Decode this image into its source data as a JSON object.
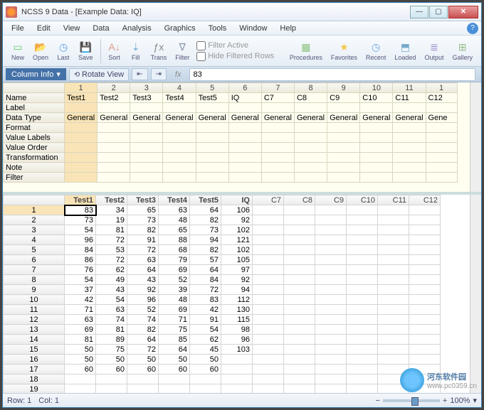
{
  "title": "NCSS 9 Data - [Example Data: IQ]",
  "menus": [
    "File",
    "Edit",
    "View",
    "Data",
    "Analysis",
    "Graphics",
    "Tools",
    "Window",
    "Help"
  ],
  "toolbar_left": [
    {
      "name": "new",
      "label": "New",
      "glyph": "▭",
      "color": "#6c6"
    },
    {
      "name": "open",
      "label": "Open",
      "glyph": "📂",
      "color": "#e9b64a"
    },
    {
      "name": "last",
      "label": "Last",
      "glyph": "◷",
      "color": "#5aa0e0"
    },
    {
      "name": "save",
      "label": "Save",
      "glyph": "💾",
      "color": "#5b8fd0"
    }
  ],
  "toolbar_mid": [
    {
      "name": "sort",
      "label": "Sort",
      "glyph": "A↓",
      "color": "#d98"
    },
    {
      "name": "fill",
      "label": "Fill",
      "glyph": "⇣",
      "color": "#7ac"
    },
    {
      "name": "trans",
      "label": "Trans",
      "glyph": "ƒx",
      "color": "#888"
    },
    {
      "name": "filter",
      "label": "Filter",
      "glyph": "∇",
      "color": "#89a"
    }
  ],
  "filter_opts": {
    "active": "Filter Active",
    "hide": "Hide Filtered Rows"
  },
  "toolbar_right": [
    {
      "name": "procedures",
      "label": "Procedures",
      "glyph": "▦",
      "color": "#8ac17c"
    },
    {
      "name": "favorites",
      "label": "Favorites",
      "glyph": "★",
      "color": "#f2c84b"
    },
    {
      "name": "recent",
      "label": "Recent",
      "glyph": "◷",
      "color": "#6aa6e0"
    },
    {
      "name": "loaded",
      "label": "Loaded",
      "glyph": "⬒",
      "color": "#7ac"
    },
    {
      "name": "output",
      "label": "Output",
      "glyph": "≣",
      "color": "#9688c8"
    },
    {
      "name": "gallery",
      "label": "Gallery",
      "glyph": "⊞",
      "color": "#9b8"
    }
  ],
  "colbar": {
    "info": "Column Info",
    "pin": "▾",
    "rotate": "Rotate View",
    "fx": "fx",
    "cell_value": "83"
  },
  "column_headers": [
    "1",
    "2",
    "3",
    "4",
    "5",
    "6",
    "7",
    "8",
    "9",
    "10",
    "11",
    "1"
  ],
  "info_rows": [
    "Name",
    "Label",
    "Data Type",
    "Format",
    "Value Labels",
    "Value Order",
    "Transformation",
    "Note",
    "Filter"
  ],
  "info_data": {
    "Name": [
      "Test1",
      "Test2",
      "Test3",
      "Test4",
      "Test5",
      "IQ",
      "C7",
      "C8",
      "C9",
      "C10",
      "C11",
      "C12"
    ],
    "Data Type": [
      "General",
      "General",
      "General",
      "General",
      "General",
      "General",
      "General",
      "General",
      "General",
      "General",
      "General",
      "Gene"
    ]
  },
  "data_headers": [
    "Test1",
    "Test2",
    "Test3",
    "Test4",
    "Test5",
    "IQ",
    "C7",
    "C8",
    "C9",
    "C10",
    "C11",
    "C12"
  ],
  "data_rows": [
    [
      83,
      34,
      65,
      63,
      64,
      106
    ],
    [
      73,
      19,
      73,
      48,
      82,
      92
    ],
    [
      54,
      81,
      82,
      65,
      73,
      102
    ],
    [
      96,
      72,
      91,
      88,
      94,
      121
    ],
    [
      84,
      53,
      72,
      68,
      82,
      102
    ],
    [
      86,
      72,
      63,
      79,
      57,
      105
    ],
    [
      76,
      62,
      64,
      69,
      64,
      97
    ],
    [
      54,
      49,
      43,
      52,
      84,
      92
    ],
    [
      37,
      43,
      92,
      39,
      72,
      94
    ],
    [
      42,
      54,
      96,
      48,
      83,
      112
    ],
    [
      71,
      63,
      52,
      69,
      42,
      130
    ],
    [
      63,
      74,
      74,
      71,
      91,
      115
    ],
    [
      69,
      81,
      82,
      75,
      54,
      98
    ],
    [
      81,
      89,
      64,
      85,
      62,
      96
    ],
    [
      50,
      75,
      72,
      64,
      45,
      103
    ],
    [
      50,
      50,
      50,
      50,
      50,
      null
    ],
    [
      60,
      60,
      60,
      60,
      60,
      null
    ],
    [],
    [],
    []
  ],
  "status": {
    "row": "Row: 1",
    "col": "Col: 1",
    "zoom": "100%"
  },
  "watermark": {
    "text": "河东软件园",
    "url": "www.pc0359.cn"
  }
}
